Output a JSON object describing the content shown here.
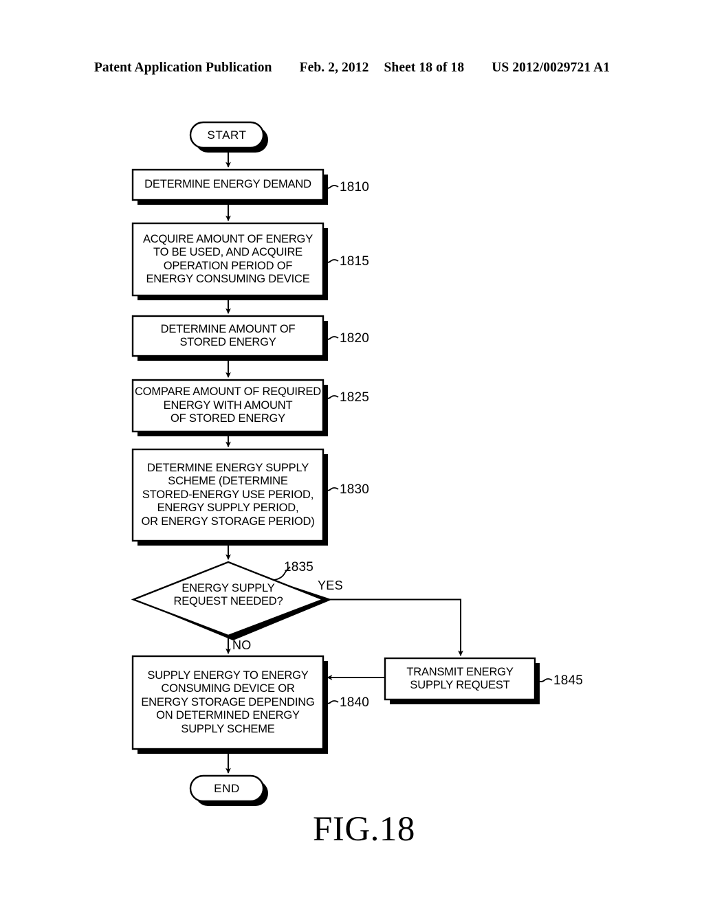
{
  "header": {
    "publication": "Patent Application Publication",
    "date": "Feb. 2, 2012",
    "sheet": "Sheet 18 of 18",
    "patent_number": "US 2012/0029721 A1"
  },
  "figure": {
    "caption": "FIG.18",
    "type": "flowchart"
  },
  "flowchart": {
    "nodes": [
      {
        "id": "start",
        "shape": "terminal",
        "label": "START",
        "ref": ""
      },
      {
        "id": "n1810",
        "shape": "process",
        "label": "DETERMINE ENERGY DEMAND",
        "ref": "1810"
      },
      {
        "id": "n1815",
        "shape": "process",
        "label": "ACQUIRE AMOUNT OF ENERGY\nTO BE USED, AND ACQUIRE\nOPERATION PERIOD OF\nENERGY CONSUMING DEVICE",
        "ref": "1815"
      },
      {
        "id": "n1820",
        "shape": "process",
        "label": "DETERMINE AMOUNT OF\nSTORED ENERGY",
        "ref": "1820"
      },
      {
        "id": "n1825",
        "shape": "process",
        "label": "COMPARE AMOUNT OF REQUIRED\nENERGY WITH AMOUNT\nOF STORED ENERGY",
        "ref": "1825"
      },
      {
        "id": "n1830",
        "shape": "process",
        "label": "DETERMINE ENERGY SUPPLY\nSCHEME (DETERMINE\nSTORED-ENERGY USE PERIOD,\nENERGY SUPPLY PERIOD,\nOR ENERGY STORAGE PERIOD)",
        "ref": "1830"
      },
      {
        "id": "n1835",
        "shape": "decision",
        "label": "ENERGY SUPPLY\nREQUEST NEEDED?",
        "ref": "1835"
      },
      {
        "id": "n1840",
        "shape": "process",
        "label": "SUPPLY ENERGY TO ENERGY\nCONSUMING DEVICE OR\nENERGY STORAGE DEPENDING\nON DETERMINED ENERGY\nSUPPLY SCHEME",
        "ref": "1840"
      },
      {
        "id": "n1845",
        "shape": "process",
        "label": "TRANSMIT ENERGY\nSUPPLY REQUEST",
        "ref": "1845"
      },
      {
        "id": "end",
        "shape": "terminal",
        "label": "END",
        "ref": ""
      }
    ],
    "branch_labels": {
      "yes": "YES",
      "no": "NO"
    }
  },
  "colors": {
    "ink": "#000000",
    "paper": "#ffffff"
  }
}
